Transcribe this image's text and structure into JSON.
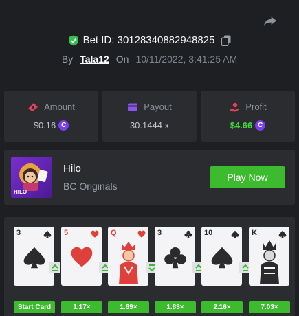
{
  "header": {
    "bet_id_label": "Bet ID: 30128340882948825",
    "by_label": "By",
    "username": "Tala12",
    "on_label": "On",
    "datetime": "10/11/2022, 3:41:25 AM"
  },
  "stats": [
    {
      "label": "Amount",
      "value": "$0.16",
      "icon": "money-icon",
      "has_coin": true
    },
    {
      "label": "Payout",
      "value": "30.1444 x",
      "icon": "wallet-icon",
      "has_coin": false
    },
    {
      "label": "Profit",
      "value": "$4.66",
      "icon": "hand-money-icon",
      "has_coin": true
    }
  ],
  "coin_symbol": "C",
  "game": {
    "title": "Hilo",
    "subtitle": "BC Originals",
    "thumb_text": "HILO",
    "play_label": "Play Now"
  },
  "cards": [
    {
      "rank": "3",
      "suit": "spade",
      "color": "black",
      "multiplier": "Start Card",
      "arrow_after": "up"
    },
    {
      "rank": "5",
      "suit": "heart",
      "color": "red",
      "multiplier": "1.17×",
      "arrow_after": "up"
    },
    {
      "rank": "Q",
      "suit": "heart",
      "color": "red",
      "multiplier": "1.69×",
      "arrow_after": "down"
    },
    {
      "rank": "3",
      "suit": "club",
      "color": "black",
      "multiplier": "1.83×",
      "arrow_after": "up"
    },
    {
      "rank": "10",
      "suit": "spade",
      "color": "black",
      "multiplier": "2.16×",
      "arrow_after": "up"
    },
    {
      "rank": "K",
      "suit": "spade",
      "color": "black",
      "multiplier": "7.03×",
      "arrow_after": null
    }
  ],
  "colors": {
    "background": "#1e1f22",
    "panel": "#2a2c30",
    "accent_green": "#3dbb2f",
    "profit_green": "#43d43e",
    "coin_purple": "#7b3ff2"
  }
}
